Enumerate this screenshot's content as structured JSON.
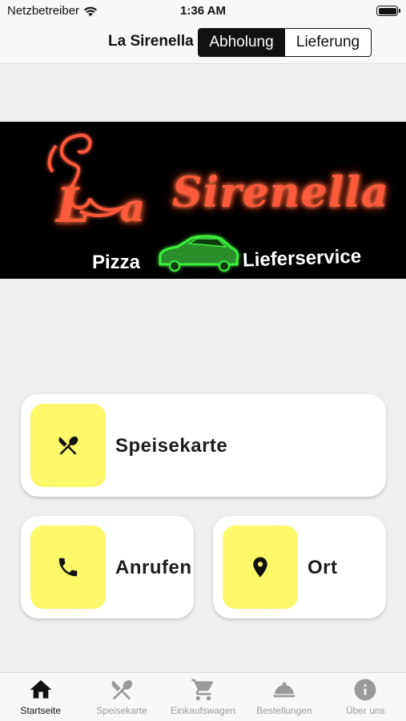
{
  "status_bar": {
    "carrier": "Netzbetreiber",
    "time": "1:36 AM"
  },
  "nav": {
    "title": "La Sirenella",
    "segments": [
      {
        "label": "Abholung",
        "selected": true
      },
      {
        "label": "Lieferung",
        "selected": false
      }
    ]
  },
  "banner": {
    "brand_first": "L",
    "brand_first_a": "a",
    "brand_rest": "Sirenella",
    "tagline_left": "Pizza",
    "tagline_right": "Lieferservice",
    "colors": {
      "glow": "#ff5a3c",
      "car": "#3cf03c"
    }
  },
  "actions": {
    "menu": {
      "label": "Speisekarte",
      "icon": "utensils-icon"
    },
    "call": {
      "label": "Anrufen",
      "icon": "phone-icon"
    },
    "location": {
      "label": "Ort",
      "icon": "location-pin-icon"
    },
    "icon_bg": "#fdf869"
  },
  "tabs": [
    {
      "label": "Startseite",
      "icon": "home-icon",
      "active": true
    },
    {
      "label": "Speisekarte",
      "icon": "utensils-icon",
      "active": false
    },
    {
      "label": "Einkaufswagen",
      "icon": "cart-icon",
      "active": false
    },
    {
      "label": "Bestellungen",
      "icon": "cloche-icon",
      "active": false
    },
    {
      "label": "Über uns",
      "icon": "info-icon",
      "active": false
    }
  ]
}
